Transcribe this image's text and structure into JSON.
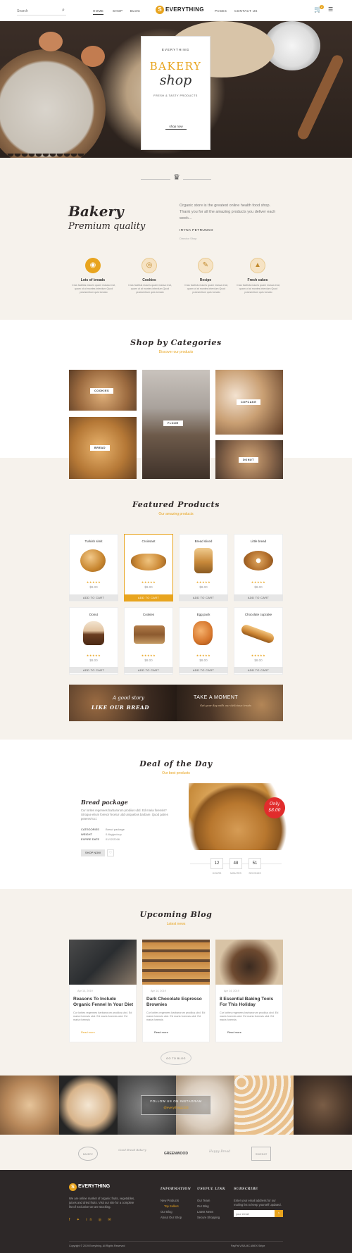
{
  "header": {
    "search_placeholder": "Search",
    "nav": [
      "HOME",
      "SHOP",
      "BLOG",
      "PAGES",
      "CONTACT US"
    ],
    "brand": "EVERYTHING",
    "cart_count": "2"
  },
  "hero": {
    "top": "EVERYTHING",
    "title1": "BAKERY",
    "title2": "shop",
    "subtitle": "FRESH & TASTY PRODUCTS",
    "cta": "shop now"
  },
  "about": {
    "title": "Bakery",
    "subtitle": "Premium quality",
    "text": "Organic store is the greatest online health food shop. Thank you for all the amazing products you deliver each week...",
    "author": "IRYNA PETRUNKO",
    "sign": "Director Shop",
    "features": [
      {
        "name": "Lots of breads",
        "text": "Cras facilisis mauris quam massa erat, quam ut at montes interdum Quod praesentium quis tomato"
      },
      {
        "name": "Cookies",
        "text": "Cras facilisis mauris quam massa erat, quam ut at montes interdum Quod praesentium quis tomato"
      },
      {
        "name": "Recipe",
        "text": "Cras facilisis mauris quam massa erat, quam ut at montes interdum Quod praesentium quis tomato"
      },
      {
        "name": "Fresh cakes",
        "text": "Cras facilisis mauris quam massa erat, quam ut at montes interdum Quod praesentium quis tomato"
      }
    ]
  },
  "categories": {
    "title": "Shop by Categories",
    "sub": "Discover our products",
    "items": [
      "COOKIES",
      "FLOUR",
      "CUPCAKE",
      "BREAD",
      "DONUT"
    ]
  },
  "featured": {
    "title": "Featured Products",
    "sub": "Our amazing products",
    "add": "ADD TO CART",
    "products": [
      {
        "name": "Turkish simit",
        "price": "$9.00"
      },
      {
        "name": "Croissant",
        "price": "$9.00"
      },
      {
        "name": "Bread sliced",
        "price": "$8.00"
      },
      {
        "name": "Little bread",
        "price": "$8.00"
      },
      {
        "name": "Donut",
        "price": "$8.00"
      },
      {
        "name": "Cookies",
        "price": "$8.00"
      },
      {
        "name": "Egg pack",
        "price": "$8.00"
      },
      {
        "name": "Chocolate cupcake",
        "price": "$8.00"
      }
    ]
  },
  "banners": {
    "left1": "A good story",
    "left2": "LIKE OUR BREAD",
    "right1": "TAKE A MOMENT",
    "right2": "Get your day with our delicious treats"
  },
  "deal": {
    "title": "Deal of the Day",
    "sub": "Our best products",
    "product": "Bread package",
    "desc": "Cur lorites regenees barbarorum prodiius ubd. Ed maria forensis? Utroque elium foresor fecetur ubd uniquebos barbare. Quod patres peteres-loci.",
    "specs": [
      [
        "CATEGORIES",
        "Bread package"
      ],
      [
        "WEIGHT",
        "0.4kg/pc/cup"
      ],
      [
        "EXPIRE DATE",
        "01/12/2016"
      ]
    ],
    "shop": "SHOP NOW",
    "badge1": "Only",
    "badge2": "$8.00",
    "timer": [
      {
        "v": "12",
        "l": "HOURS"
      },
      {
        "v": "48",
        "l": "MINUTES"
      },
      {
        "v": "51",
        "l": "SECONDS"
      }
    ]
  },
  "blog": {
    "title": "Upcoming Blog",
    "sub": "Latest news",
    "date": "Apr 14, 2019",
    "read": "Read more",
    "go": "GO TO BLOG",
    "posts": [
      {
        "title": "Reasons To Include Organic Fennel In Your Diet",
        "text": "Cur lorites regenees barbarorum prodiius ubd. Ed maria forensis ubd. Ed maria forensis ubd. Ed maria forensis"
      },
      {
        "title": "Dark Chocolate Espresso Brownies",
        "text": "Cur lorites regenees barbarorum prodiius ubd. Ed maria forensis ubd. Ed maria forensis ubd. Ed maria forensis"
      },
      {
        "title": "8 Essential Baking Tools For This Holiday",
        "text": "Cur lorites regenees barbarorum prodiius ubd. Ed maria forensis ubd. Ed maria forensis ubd. Ed maria forensis"
      }
    ]
  },
  "instagram": {
    "line1": "FOLLOW US ON INSTAGRAM",
    "line2": "@everything1333"
  },
  "brands": [
    "BAKERY",
    "Good Bread Bakery",
    "GREENWOOD",
    "Happy Bread",
    "SWEEAT"
  ],
  "footer": {
    "brand": "EVERYTHING",
    "about": "We are online market of organic fruits, vegetables, juices and dried fruits. Visit our site for a complete list of exclusive we are stocking.",
    "col1": "INFORMATION",
    "col1_items": [
      "New Products",
      "Top Sellers",
      "Our Blog",
      "About Our Shop"
    ],
    "col2": "USEFUL LINK",
    "col2_items": [
      "Our Team",
      "Our Blog",
      "Latest News",
      "Secure Shopping"
    ],
    "col3": "SUBSCRIBE",
    "col3_text": "Enter your email address for our mailing list to keep yourself updated.",
    "email_ph": "your email",
    "copy": "Copyright © 2019 Everything. All Rights Reserved",
    "pay": "PayPal  VISA  MC  AMEX  Stripe"
  },
  "colors": {
    "accent": "#e8a41e",
    "dark": "#2d2828",
    "cream": "#f6f2ec"
  }
}
